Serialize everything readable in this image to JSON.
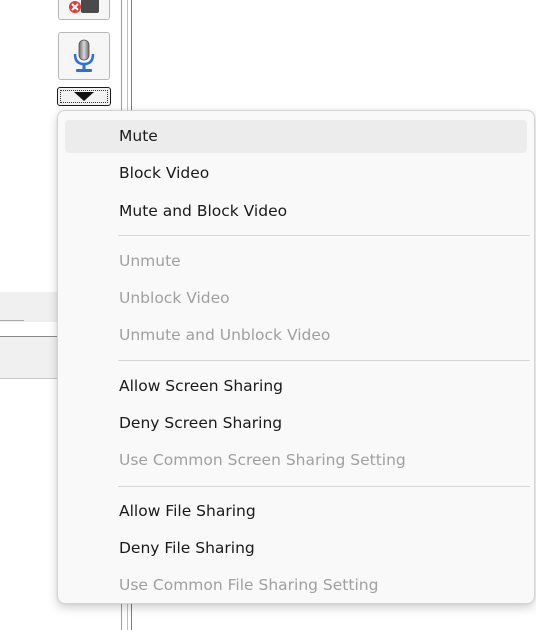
{
  "background": {
    "icons": {
      "remove_user": "remove-user-icon",
      "microphone": "microphone-icon",
      "dropdown": "triangle-down-icon"
    }
  },
  "menu": {
    "groups": [
      {
        "items": [
          {
            "label": "Mute",
            "enabled": true,
            "highlighted": true
          },
          {
            "label": "Block Video",
            "enabled": true
          },
          {
            "label": "Mute and Block Video",
            "enabled": true
          }
        ]
      },
      {
        "items": [
          {
            "label": "Unmute",
            "enabled": false
          },
          {
            "label": "Unblock Video",
            "enabled": false
          },
          {
            "label": "Unmute and Unblock Video",
            "enabled": false
          }
        ]
      },
      {
        "items": [
          {
            "label": "Allow Screen Sharing",
            "enabled": true
          },
          {
            "label": "Deny Screen Sharing",
            "enabled": true
          },
          {
            "label": "Use Common Screen Sharing Setting",
            "enabled": false
          }
        ]
      },
      {
        "items": [
          {
            "label": "Allow File Sharing",
            "enabled": true
          },
          {
            "label": "Deny File Sharing",
            "enabled": true
          },
          {
            "label": "Use Common File Sharing Setting",
            "enabled": false
          }
        ]
      }
    ]
  },
  "colors": {
    "menu_background": "#f9f9f9",
    "hover_background": "#ececec",
    "enabled_text": "#1a1a1a",
    "disabled_text": "#a0a0a0",
    "separator": "#d6d6d6"
  }
}
